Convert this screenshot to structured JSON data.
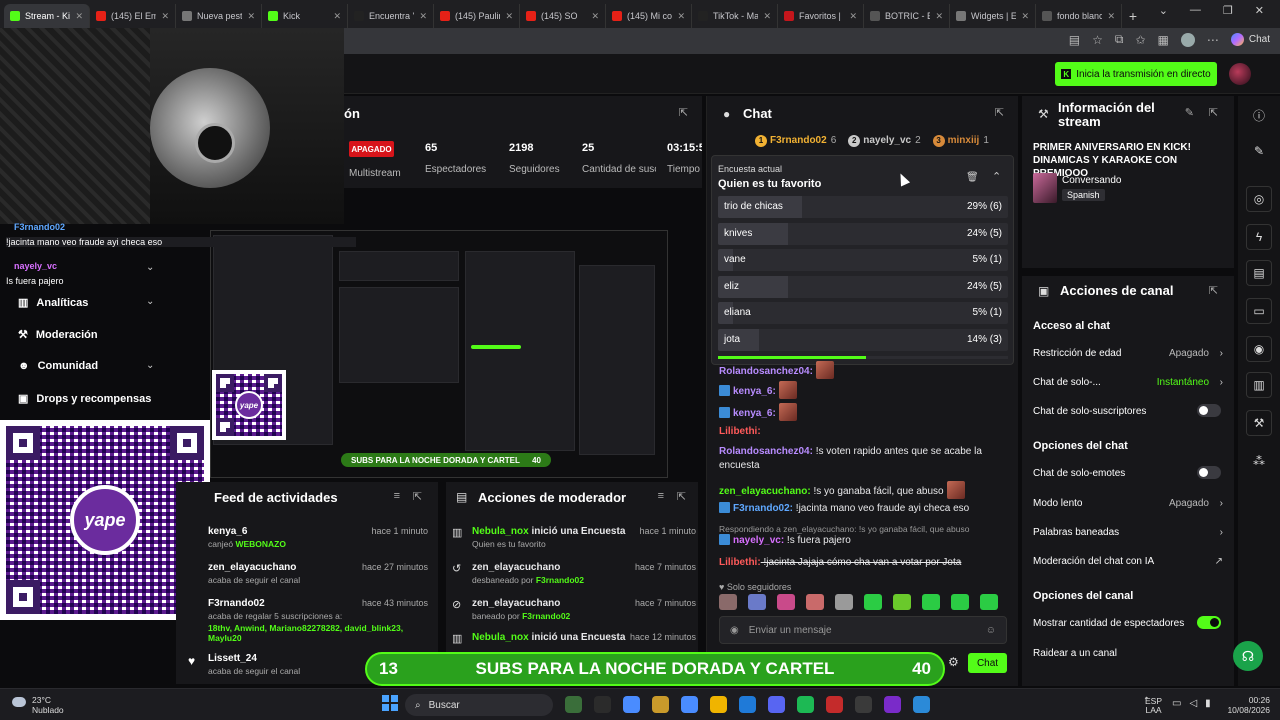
{
  "browser": {
    "tabs": [
      {
        "label": "Stream - Kick",
        "color": "#53fc18",
        "active": true
      },
      {
        "label": "(145) El Emb",
        "color": "#e62117"
      },
      {
        "label": "Nueva pestañ",
        "color": "#777"
      },
      {
        "label": "Kick",
        "color": "#53fc18"
      },
      {
        "label": "Encuentra 'C",
        "color": "#222"
      },
      {
        "label": "(145) Paulina",
        "color": "#e62117"
      },
      {
        "label": "(145) SO",
        "color": "#e62117"
      },
      {
        "label": "(145) Mi cor",
        "color": "#e62117"
      },
      {
        "label": "TikTok - Mak",
        "color": "#222"
      },
      {
        "label": "Favoritos | M",
        "color": "#c4161c"
      },
      {
        "label": "BOTRIC - Bús",
        "color": "#555"
      },
      {
        "label": "Widgets | El",
        "color": "#777"
      },
      {
        "label": "fondo blanc",
        "color": "#555"
      }
    ],
    "chat_chip": "Chat"
  },
  "header": {
    "go_live": "Inicia la transmisión en directo"
  },
  "webcam_overlay": {
    "user1": "F3rnando02",
    "msg1": "!jacinta mano veo fraude ayi checa eso",
    "user2": "nayely_vc",
    "msg2": "Is fuera pajero"
  },
  "stats": {
    "title_fragment": "ón",
    "status": "APAGADO",
    "multistream": "Multistream",
    "viewers": "65",
    "viewers_label": "Espectadores",
    "followers": "2198",
    "followers_label": "Seguidores",
    "subs": "25",
    "subs_label": "Cantidad de suscripciones",
    "time": "03:15:5",
    "time_label": "Tiempo"
  },
  "sidenav": {
    "items": [
      "Analíticas",
      "Moderación",
      "Comunidad",
      "Drops y recompensas"
    ]
  },
  "yape": {
    "label": "yape"
  },
  "preview_banner": {
    "left": "SUBS PARA LA NOCHE DORADA Y CARTEL",
    "right": "40"
  },
  "feed": {
    "title": "Feed de actividades",
    "items": [
      {
        "name": "kenya_6",
        "sub": "canjeó",
        "highlight": "WEBONAZO",
        "time": "hace 1 minuto"
      },
      {
        "name": "zen_elayacuchano",
        "sub": "acaba de seguir el canal",
        "time": "hace 27 minutos"
      },
      {
        "name": "F3rnando02",
        "sub": "acaba de regalar 5 suscripciones a:",
        "gifted": "18thv, Anwind, Mariano82278282, david_blink23, Maylu20",
        "time": "hace 43 minutos"
      },
      {
        "name": "Lissett_24",
        "sub": "acaba de seguir el canal"
      }
    ]
  },
  "modactions": {
    "title": "Acciones de moderador",
    "items": [
      {
        "user": "Nebula_nox",
        "action": " inició una Encuesta",
        "sub": "Quien es tu favorito",
        "time": "hace 1 minuto"
      },
      {
        "user": "zen_elayacuchano",
        "action": "",
        "sub": "desbaneado por ",
        "by": "F3rnando02",
        "time": "hace 7 minutos"
      },
      {
        "user": "zen_elayacuchano",
        "action": "",
        "sub": "baneado por ",
        "by": "F3rnando02",
        "time": "hace 7 minutos"
      },
      {
        "user": "Nebula_nox",
        "action": " inició una Encuesta",
        "time": "hace 12 minutos"
      }
    ]
  },
  "chat": {
    "title": "Chat",
    "top_gifters": [
      {
        "rank": "1",
        "name": "F3rnando02",
        "count": "6",
        "color": "#f2b233"
      },
      {
        "rank": "2",
        "name": "nayely_vc",
        "count": "2",
        "color": "#c9c9c9"
      },
      {
        "rank": "3",
        "name": "minxiij",
        "count": "1",
        "color": "#d78a3a"
      }
    ],
    "poll": {
      "header": "Encuesta actual",
      "question": "Quien es tu favorito",
      "options": [
        {
          "label": "trio de chicas",
          "pct": "29% (6)",
          "value": 29
        },
        {
          "label": "knives",
          "pct": "24% (5)",
          "value": 24
        },
        {
          "label": "vane",
          "pct": "5% (1)",
          "value": 5
        },
        {
          "label": "eliz",
          "pct": "24% (5)",
          "value": 24
        },
        {
          "label": "eliana",
          "pct": "5% (1)",
          "value": 5
        },
        {
          "label": "jota",
          "pct": "14% (3)",
          "value": 14
        }
      ],
      "time_progress": 0.51
    },
    "messages": [
      {
        "user": "Rolandosanchez04:",
        "color": "#b88cff",
        "text": ""
      },
      {
        "user": "kenya_6:",
        "color": "#b88cff",
        "text": ""
      },
      {
        "user": "kenya_6:",
        "color": "#b88cff",
        "text": ""
      },
      {
        "user": "Lilibethi:",
        "color": "#ff5a5a",
        "text": ""
      },
      {
        "user": "Rolandosanchez04:",
        "color": "#b88cff",
        "text": " !s voten rapido antes que se acabe la encuesta"
      },
      {
        "user": "zen_elayacuchano:",
        "color": "#53fc18",
        "text": " !s yo ganaba fácil, que abuso"
      },
      {
        "user": "F3rnando02:",
        "color": "#5fa8ff",
        "text": " !jacinta mano veo fraude ayi checa eso"
      },
      {
        "user": "nayely_vc:",
        "color": "#d870ff",
        "text": " !s fuera pajero"
      },
      {
        "user": "Lilibethi:",
        "color": "#ff5a5a",
        "text": " !jacinta Jajaja cómo cha van a votar por Jota"
      }
    ],
    "reply_hint": "Respondiendo a zen_elayacuchano: !s yo ganaba fácil, que abuso",
    "followers_only": "Solo seguidores",
    "placeholder": "Enviar un mensaje",
    "send": "Chat",
    "sub_emote_colors": [
      "#8a6a6a",
      "#6a7ac9",
      "#c94a8a",
      "#c96a6a",
      "#9a9a9a",
      "#2bcc44",
      "#6ac92b",
      "#2bcc44",
      "#2bcc44",
      "#2bcc44"
    ]
  },
  "info": {
    "title": "Información del stream",
    "stream_title": "PRIMER ANIVERSARIO EN KICK! DINAMICAS Y KARAOKE CON PREMIOOO",
    "category": "Conversando",
    "language": "Spanish"
  },
  "acciones": {
    "title": "Acciones de canal",
    "sec1": "Acceso al chat",
    "age": "Restricción de edad",
    "age_val": "Apagado",
    "solo": "Chat de solo-...",
    "solo_val": "Instantáneo",
    "subs_only": "Chat de solo-suscriptores",
    "sec2": "Opciones del chat",
    "emotes": "Chat de solo-emotes",
    "slow": "Modo lento",
    "slow_val": "Apagado",
    "banned": "Palabras baneadas",
    "ai_mod": "Moderación del chat con IA",
    "sec3": "Opciones del canal",
    "show_viewers": "Mostrar cantidad de espectadores",
    "raid": "Raidear a un canal"
  },
  "banner": {
    "left": "13",
    "text": "SUBS PARA LA NOCHE DORADA Y CARTEL",
    "right": "40"
  },
  "taskbar": {
    "temp": "23°C",
    "weather": "Nublado",
    "search": "Buscar",
    "lang1": "ESP",
    "lang2": "LAA",
    "time": "00:26",
    "date": "10/08/2026"
  }
}
